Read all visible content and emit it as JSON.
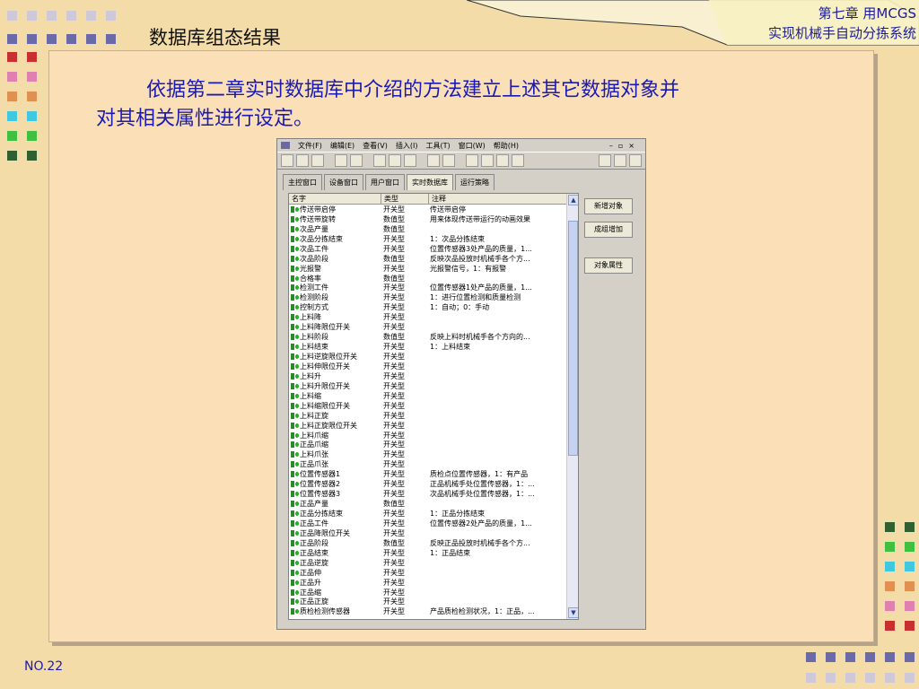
{
  "header": {
    "title": "数据库组态结果",
    "chapter_line1": "第七章 用MCGS",
    "chapter_line2": "实现机械手自动分拣系统"
  },
  "intro": {
    "line1": "依据第二章实时数据库中介绍的方法建立上述其它数据对象并",
    "line2": "对其相关属性进行设定。"
  },
  "window": {
    "menu": [
      "文件(F)",
      "编辑(E)",
      "查看(V)",
      "插入(I)",
      "工具(T)",
      "窗口(W)",
      "帮助(H)"
    ],
    "tabs": [
      "主控窗口",
      "设备窗口",
      "用户窗口",
      "实时数据库",
      "运行策略"
    ],
    "columns": [
      "名字",
      "类型",
      "注释"
    ],
    "rows": [
      [
        "传送带启停",
        "开关型",
        "传送带启停"
      ],
      [
        "传送带旋转",
        "数值型",
        "用来体现传送带运行的动画效果"
      ],
      [
        "次品产量",
        "数值型",
        ""
      ],
      [
        "次品分拣结束",
        "开关型",
        "1：次品分拣结束"
      ],
      [
        "次品工件",
        "开关型",
        "位置传感器3处产品的质量，1..."
      ],
      [
        "次品阶段",
        "数值型",
        "反映次品投放时机械手各个方..."
      ],
      [
        "光报警",
        "开关型",
        "光报警信号，1：有报警"
      ],
      [
        "合格率",
        "数值型",
        ""
      ],
      [
        "检测工件",
        "开关型",
        "位置传感器1处产品的质量，1..."
      ],
      [
        "检测阶段",
        "开关型",
        "1：进行位置检测和质量检测"
      ],
      [
        "控制方式",
        "开关型",
        "1：自动；0：手动"
      ],
      [
        "上料降",
        "开关型",
        ""
      ],
      [
        "上料降限位开关",
        "开关型",
        ""
      ],
      [
        "上料阶段",
        "数值型",
        "反映上料时机械手各个方向的..."
      ],
      [
        "上料结束",
        "开关型",
        "1：上料结束"
      ],
      [
        "上料逆旋限位开关",
        "开关型",
        ""
      ],
      [
        "上料伸限位开关",
        "开关型",
        ""
      ],
      [
        "上料升",
        "开关型",
        ""
      ],
      [
        "上料升限位开关",
        "开关型",
        ""
      ],
      [
        "上料缩",
        "开关型",
        ""
      ],
      [
        "上料缩限位开关",
        "开关型",
        ""
      ],
      [
        "上料正旋",
        "开关型",
        ""
      ],
      [
        "上料正旋限位开关",
        "开关型",
        ""
      ],
      [
        "上料爪缩",
        "开关型",
        ""
      ],
      [
        "正品爪缩",
        "开关型",
        ""
      ],
      [
        "上料爪张",
        "开关型",
        ""
      ],
      [
        "正品爪张",
        "开关型",
        ""
      ],
      [
        "位置传感器1",
        "开关型",
        "质检点位置传感器，1：有产品"
      ],
      [
        "位置传感器2",
        "开关型",
        "正品机械手处位置传感器，1：..."
      ],
      [
        "位置传感器3",
        "开关型",
        "次品机械手处位置传感器，1：..."
      ],
      [
        "正品产量",
        "数值型",
        ""
      ],
      [
        "正品分拣结束",
        "开关型",
        "1：正品分拣结束"
      ],
      [
        "正品工件",
        "开关型",
        "位置传感器2处产品的质量，1..."
      ],
      [
        "正品降限位开关",
        "开关型",
        ""
      ],
      [
        "正品阶段",
        "数值型",
        "反映正品投放时机械手各个方..."
      ],
      [
        "正品结束",
        "开关型",
        "1：正品结束"
      ],
      [
        "正品逆旋",
        "开关型",
        ""
      ],
      [
        "正品伸",
        "开关型",
        ""
      ],
      [
        "正品升",
        "开关型",
        ""
      ],
      [
        "正品缩",
        "开关型",
        ""
      ],
      [
        "正品正旋",
        "开关型",
        ""
      ],
      [
        "质检检测传感器",
        "开关型",
        "产品质检检测状况，1：正品，..."
      ]
    ],
    "buttons": [
      "新增对象",
      "成组增加",
      "对象属性"
    ]
  },
  "footer": {
    "page": "NO.22"
  }
}
